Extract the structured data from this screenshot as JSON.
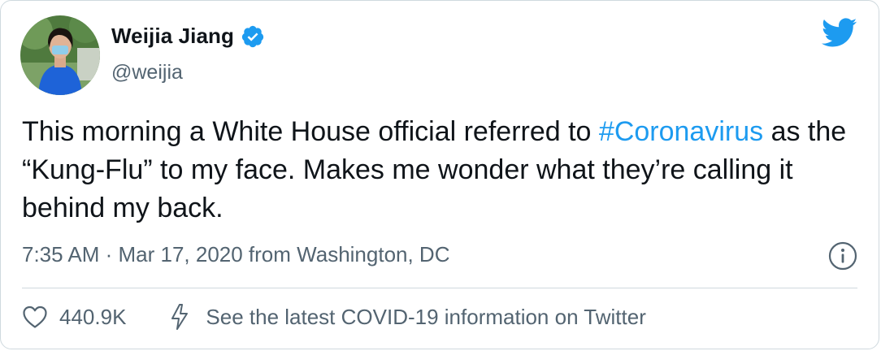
{
  "author": {
    "name": "Weijia Jiang",
    "handle": "@weijia",
    "verified": true
  },
  "tweet": {
    "text_part1": "This morning a White House official referred to ",
    "hashtag": "#Coronavirus",
    "text_part2": " as the “Kung-Flu” to my face. Makes me wonder what they’re calling it behind my back."
  },
  "meta": {
    "line": "7:35 AM · Mar 17, 2020 from Washington, DC"
  },
  "actions": {
    "likes": "440.9K",
    "covid_link": "See the latest COVID-19 information on Twitter"
  },
  "icons": {
    "logo": "twitter-bird-icon",
    "verified": "verified-badge-icon",
    "info": "info-icon",
    "like": "heart-icon",
    "covid": "lightning-bolt-icon"
  },
  "colors": {
    "accent": "#1d9bf0",
    "text": "#0f1419",
    "secondary_text": "#536471",
    "border": "#cfd9de"
  }
}
